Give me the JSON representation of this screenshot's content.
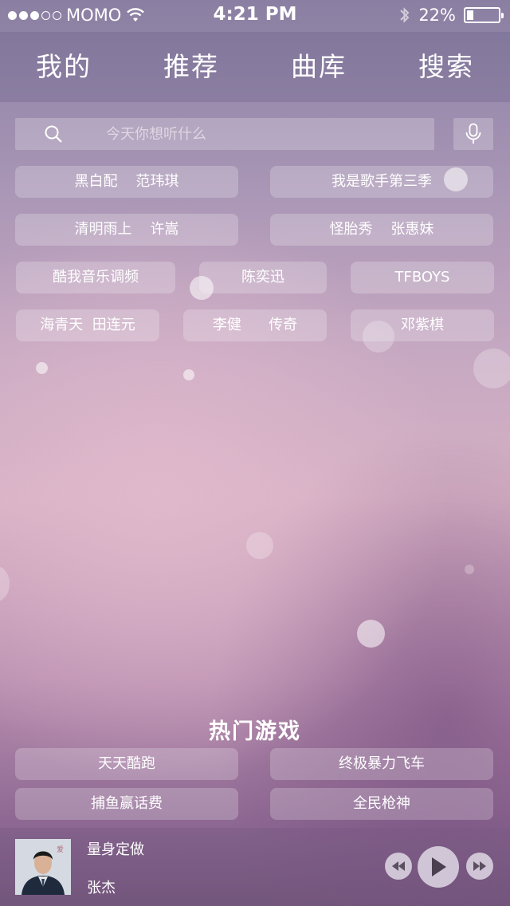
{
  "status_bar": {
    "signal_filled": 3,
    "signal_total": 5,
    "carrier": "MOMO",
    "time": "4:21 PM",
    "battery_percent": "22%",
    "battery_level": 0.22
  },
  "nav": {
    "tabs": [
      {
        "label": "我的"
      },
      {
        "label": "推荐"
      },
      {
        "label": "曲库"
      },
      {
        "label": "搜索"
      }
    ]
  },
  "search": {
    "placeholder": "今天你想听什么"
  },
  "tags": [
    {
      "label": "黑白配    范玮琪"
    },
    {
      "label": "我是歌手第三季"
    },
    {
      "label": "清明雨上    许嵩"
    },
    {
      "label": "怪胎秀    张惠妹"
    },
    {
      "label": "酷我音乐调频"
    },
    {
      "label": "陈奕迅"
    },
    {
      "label": "TFBOYS"
    },
    {
      "label": "海青天  田连元"
    },
    {
      "label": "李健      传奇"
    },
    {
      "label": "邓紫棋"
    }
  ],
  "hot_games": {
    "title": "热门游戏",
    "items": [
      {
        "label": "天天酷跑"
      },
      {
        "label": "终极暴力飞车"
      },
      {
        "label": "捕鱼赢话费"
      },
      {
        "label": "全民枪神"
      }
    ]
  },
  "player": {
    "song_title": "量身定做",
    "artist": "张杰"
  },
  "colors": {
    "accent_text": "#ffffff",
    "nav_bg": "#6e648c"
  }
}
